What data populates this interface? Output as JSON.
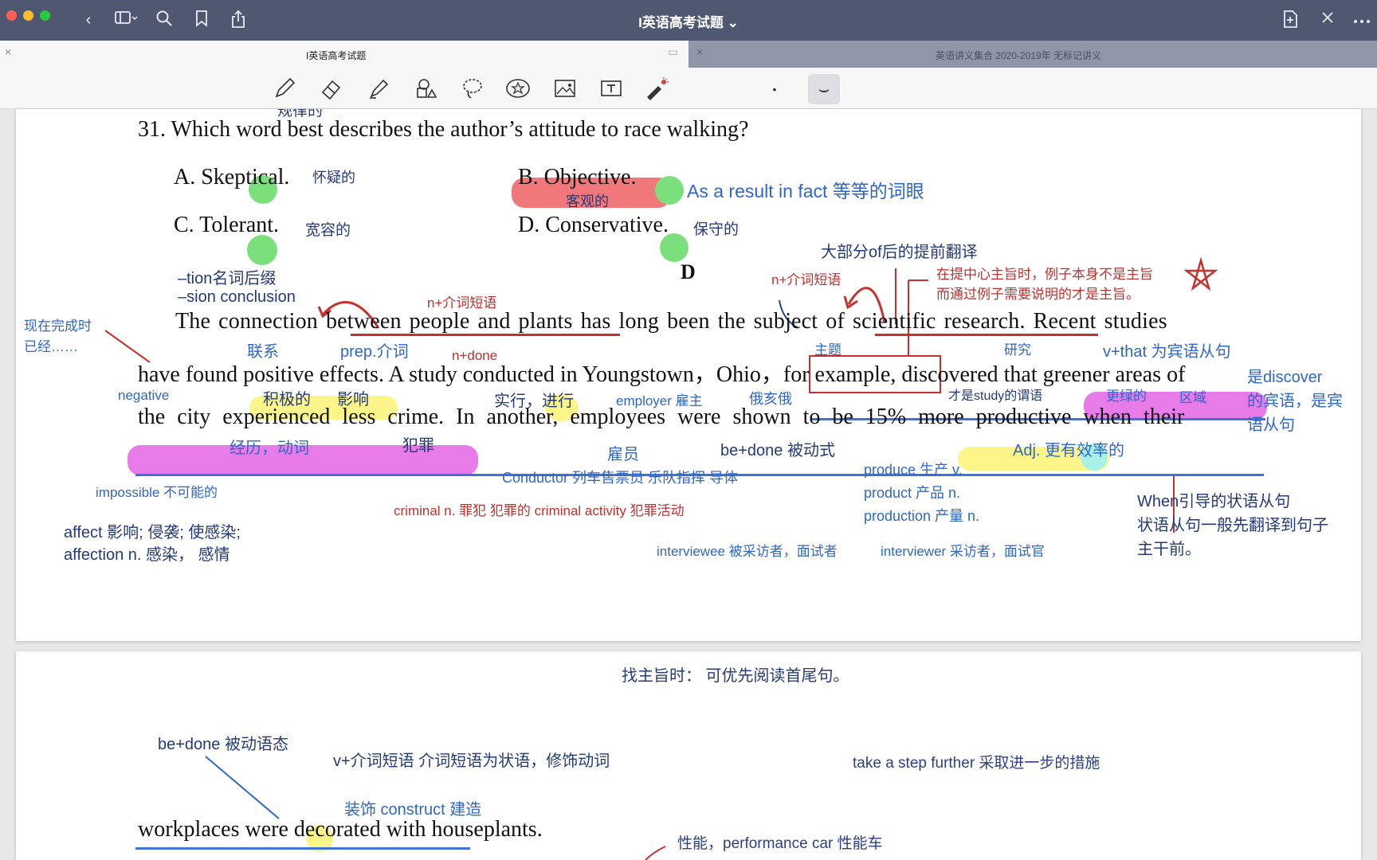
{
  "window": {
    "title": "I英语高考试题 ⌄"
  },
  "tabs": [
    {
      "label": "I英语高考试题",
      "active": true
    },
    {
      "label": "英语讲义集合 2020-2019年 无标记讲义",
      "active": false
    }
  ],
  "toolbar": {
    "tools": [
      "pen-icon",
      "eraser-icon",
      "highlighter-icon",
      "shapes-icon",
      "lasso-icon",
      "sticker-icon",
      "image-icon",
      "text-icon",
      "laser-pointer-icon"
    ],
    "pen_size_dot": "•",
    "pen_stroke_preview": "⌣"
  },
  "page1": {
    "top_note": "规律的",
    "question": "31. Which word best describes the author’s attitude to race walking?",
    "options": {
      "a": "A. Skeptical.",
      "b": "B. Objective.",
      "c": "C. Tolerant.",
      "d": "D. Conservative."
    },
    "option_notes": {
      "a": "怀疑的",
      "b": "客观的",
      "c": "宽容的",
      "d": "保守的",
      "b_side": "As a result    in fact 等等的词眼"
    },
    "section_letter": "D",
    "passage": {
      "line1": "The connection between people and plants has long been the subject of scientific research. Recent studies",
      "line2": "have found positive effects. A study conducted in Youngstown，Ohio，for example, discovered that greener areas of",
      "line3": "the city experienced less crime. In another, employees were shown to be 15% more productive when their"
    },
    "annotations": {
      "tion": "–tion名词后缀",
      "sion": "–sion conclusion",
      "n_prep_phrase_1": "n+介词短语",
      "n_prep_phrase_2": "n+介词短语",
      "of_translate": "大部分of后的提前翻译",
      "main_idea_1": "在提中心主旨时，例子本身不是主旨",
      "main_idea_2": "而通过例子需要说明的才是主旨。",
      "present_perfect_1": "现在完成时",
      "present_perfect_2": "已经……",
      "connection": "联系",
      "prep": "prep.介词",
      "n_done": "n+done",
      "theme": "主题",
      "research": "研究",
      "v_that": "v+that 为宾语从句",
      "negative": "negative",
      "positive": "积极的",
      "effect": "影响",
      "conduct": "实行，进行",
      "employer": "employer 雇主",
      "ohio": "俄亥俄",
      "study_predicate": "才是study的谓语",
      "greener": "更绿的",
      "area": "区域",
      "discover_obj_1": "是discover",
      "discover_obj_2": "的宾语，是宾",
      "discover_obj_3": "语从句",
      "experience": "经历，动词",
      "crime": "犯罪",
      "employee": "雇员",
      "be_done": "be+done 被动式",
      "adj_productive": "Adj. 更有效率的",
      "conductor": "Conductor  列车售票员   乐队指挥  导体",
      "produce": "produce 生产 v.",
      "product": "product 产品  n.",
      "production": "production 产量 n.",
      "impossible": "impossible 不可能的",
      "criminal": "criminal  n. 罪犯    犯罪的 criminal activity 犯罪活动",
      "when_1": "When引导的状语从句",
      "when_2": "状语从句一般先翻译到句子",
      "when_3": "主干前。",
      "affect": "affect 影响; 侵袭; 使感染;",
      "affection": "affection n. 感染，  感情",
      "interviewee": "interviewee 被采访者，面试者",
      "interviewer": "interviewer 采访者，面试官"
    }
  },
  "page2": {
    "main_idea_tip": "找主旨时：  可优先阅读首尾句。",
    "be_done_passive": "be+done 被动语态",
    "v_prep_phrase": "v+介词短语   介词短语为状语，修饰动词",
    "take_a_step": "take a step further 采取进一步的措施",
    "decorate_note": "装饰 construct 建造",
    "sentence": "workplaces were decorated with houseplants.",
    "performance": "性能，performance car 性能车"
  },
  "colors": {
    "titlebar": "#4f5870",
    "annotation_blue": "#2f66c9",
    "annotation_red": "#c0302c",
    "highlight_green": "#7be07b",
    "highlight_yellow": "#fbf58a",
    "highlight_magenta": "#e77be8",
    "highlight_red": "#f0787a",
    "underline_blue": "#3e72d6",
    "underline_red": "#c6312d"
  }
}
